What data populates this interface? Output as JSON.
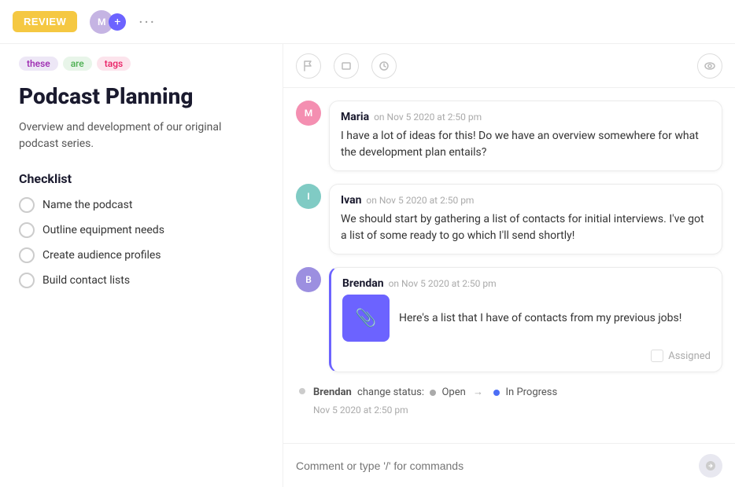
{
  "header": {
    "review_label": "REVIEW",
    "dots": "···"
  },
  "tags": [
    {
      "label": "these",
      "style": "tag-purple"
    },
    {
      "label": "are",
      "style": "tag-green"
    },
    {
      "label": "tags",
      "style": "tag-pink"
    }
  ],
  "page": {
    "title": "Podcast Planning",
    "description": "Overview and development of our original podcast series."
  },
  "checklist": {
    "title": "Checklist",
    "items": [
      {
        "label": "Name the podcast"
      },
      {
        "label": "Outline equipment needs"
      },
      {
        "label": "Create audience profiles"
      },
      {
        "label": "Build contact lists"
      }
    ]
  },
  "comments": [
    {
      "author": "Maria",
      "time": "on Nov 5 2020 at 2:50 pm",
      "text": "I have a lot of ideas for this! Do we have an overview somewhere for what the development plan entails?",
      "avatar_color": "#f48fb1"
    },
    {
      "author": "Ivan",
      "time": "on Nov 5 2020 at 2:50 pm",
      "text": "We should start by gathering a list of contacts for initial interviews. I've got a list of some ready to go which I'll send shortly!",
      "avatar_color": "#80cbc4"
    }
  ],
  "brendan_comment": {
    "author": "Brendan",
    "time": "on Nov 5 2020 at 2:50 pm",
    "text": "Here's a list that I have of contacts from my previous jobs!",
    "avatar_color": "#9c8fe0",
    "attachment_icon": "📎",
    "assigned_label": "Assigned"
  },
  "status_change": {
    "author": "Brendan",
    "prefix": "change status:",
    "from_label": "Open",
    "arrow": "→",
    "to_label": "In Progress",
    "time": "Nov 5 2020 at 2:50 pm"
  },
  "comment_input": {
    "placeholder": "Comment or type '/' for commands"
  }
}
